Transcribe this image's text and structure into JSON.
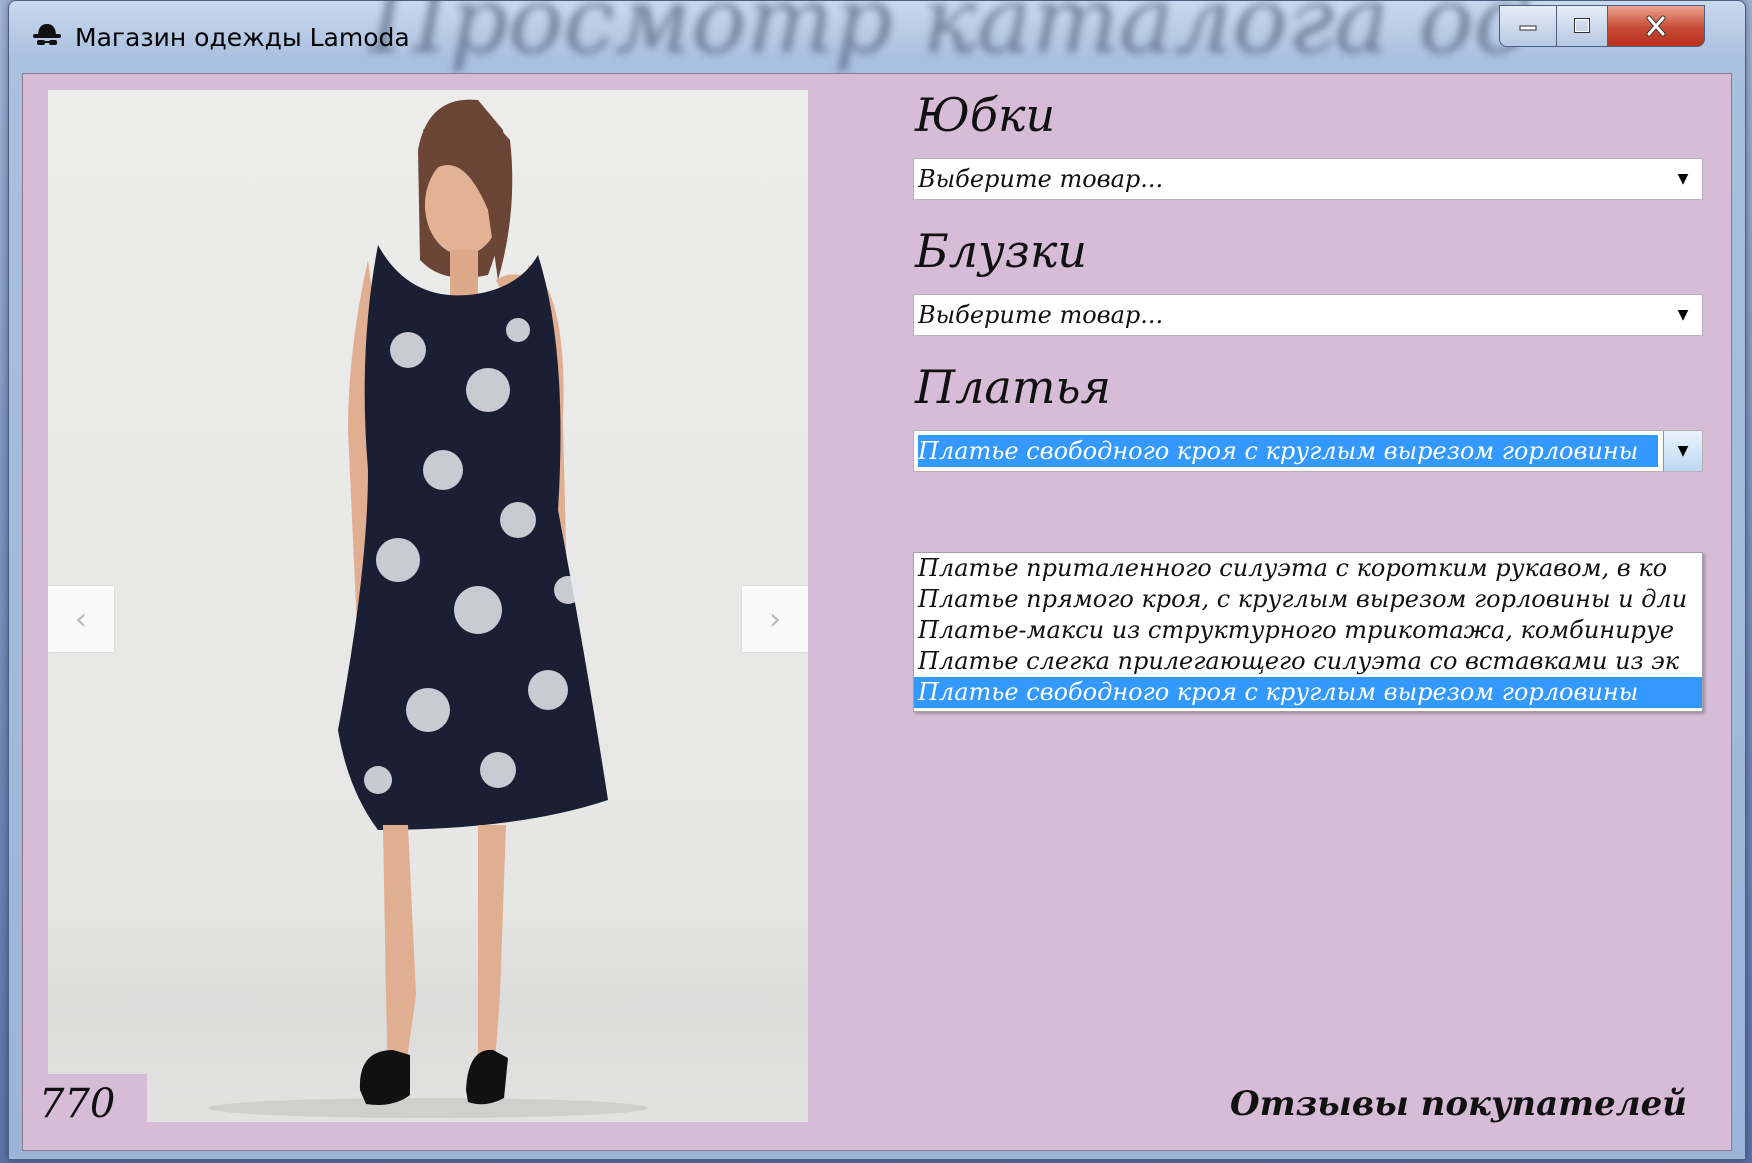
{
  "window": {
    "title": "Магазин одежды Lamoda",
    "background_title": "Просмотр каталога од"
  },
  "product": {
    "price": "770",
    "prev_icon": "chevron-left-icon",
    "next_icon": "chevron-right-icon"
  },
  "categories": {
    "skirts": {
      "label": "Юбки",
      "value": "Выберите товар..."
    },
    "blouses": {
      "label": "Блузки",
      "value": "Выберите товар..."
    },
    "dresses": {
      "label": "Платья",
      "value": "Платье свободного кроя с круглым вырезом горловины",
      "options": [
        "Платье приталенного силуэта с коротким рукавом, в ко",
        "Платье прямого кроя, с круглым вырезом горловины и дли",
        "Платье-макси из структурного трикотажа, комбинируе",
        "Платье слегка прилегающего силуэта со вставками из эк",
        "Платье свободного кроя с круглым вырезом горловины"
      ]
    }
  },
  "footer": {
    "reviews_link": "Отзывы покупателей"
  },
  "colors": {
    "client_bg": "#d7bcd7",
    "selection": "#3399ff",
    "close_button": "#c74b35"
  }
}
